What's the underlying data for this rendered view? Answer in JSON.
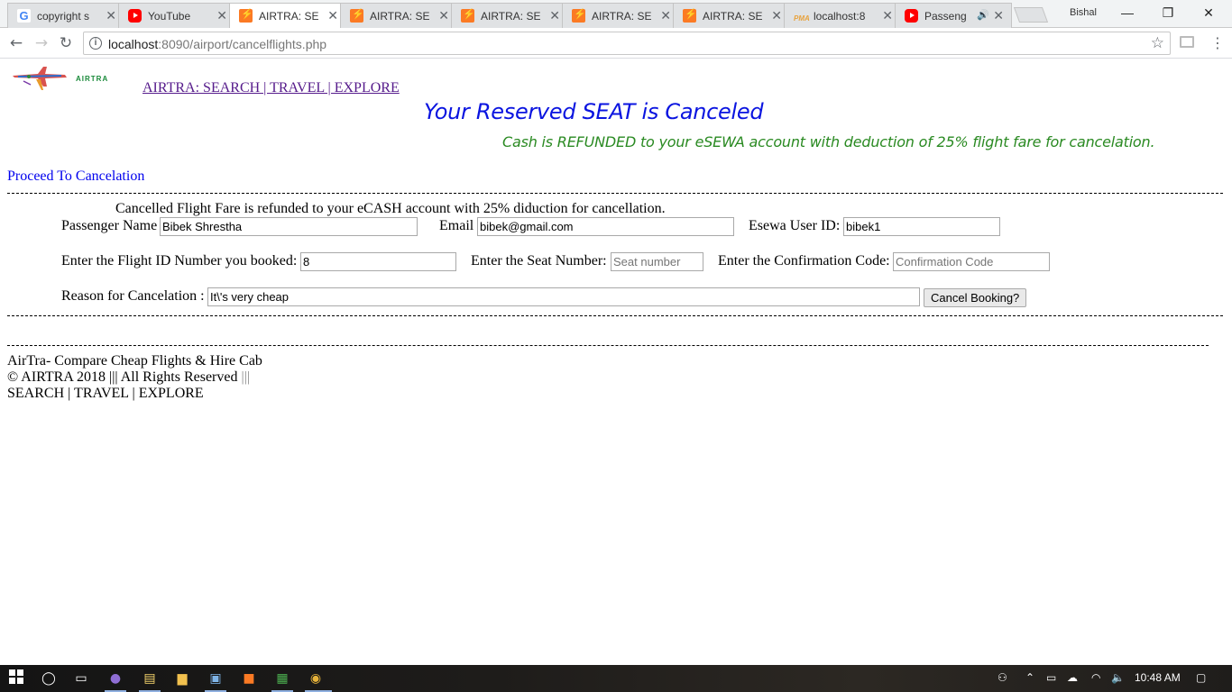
{
  "browser": {
    "tabs": [
      {
        "label": "copyright s",
        "icon": "google-icon"
      },
      {
        "label": "YouTube",
        "icon": "youtube-icon"
      },
      {
        "label": "AIRTRA: SE",
        "icon": "xampp-icon"
      },
      {
        "label": "AIRTRA: SE",
        "icon": "xampp-icon"
      },
      {
        "label": "AIRTRA: SE",
        "icon": "xampp-icon"
      },
      {
        "label": "AIRTRA: SE",
        "icon": "xampp-icon"
      },
      {
        "label": "AIRTRA: SE",
        "icon": "xampp-icon"
      },
      {
        "label": "localhost:8",
        "icon": "phpmyadmin-icon"
      },
      {
        "label": "Passeng",
        "icon": "youtube-icon"
      }
    ],
    "active_tab": 2,
    "profile_name": "Bishal",
    "url_host": "localhost",
    "url_rest": ":8090/airport/cancelflights.php"
  },
  "page": {
    "logo_text": "AIRTRA",
    "nav_link": "AIRTRA: SEARCH | TRAVEL | EXPLORE",
    "headline": "Your Reserved SEAT is Canceled",
    "subhead": "Cash is REFUNDED to your eSEWA account with deduction of 25% flight fare for cancelation.",
    "proceed_link": "Proceed To Cancelation",
    "refund_note": "Cancelled Flight Fare is refunded to your eCASH account with 25% diduction for cancellation.",
    "form": {
      "passenger_label": "Passenger Name",
      "passenger_value": "Bibek Shrestha",
      "email_label": "Email",
      "email_value": "bibek@gmail.com",
      "esewa_label": "Esewa User ID:",
      "esewa_value": "bibek1",
      "flight_label": "Enter the Flight ID Number you booked:",
      "flight_value": "8",
      "seat_label": "Enter the Seat Number:",
      "seat_placeholder": "Seat number",
      "code_label": "Enter the Confirmation Code:",
      "code_placeholder": "Confirmation Code",
      "reason_label": "Reason for Cancelation :",
      "reason_value": "It\\'s very cheap",
      "submit_label": "Cancel Booking?"
    },
    "footer": {
      "tagline": "AirTra- Compare Cheap Flights & Hire Cab",
      "copyright": "© AIRTRA 2018",
      "rights": "||| All Rights Reserved",
      "rights_end": "|||",
      "links": "SEARCH | TRAVEL | EXPLORE"
    }
  },
  "taskbar": {
    "time": "10:48 AM"
  },
  "colors": {
    "headline": "#0a14e0",
    "subhead": "#2a8a22",
    "visited_link": "#551a8b",
    "link": "#0000ee"
  }
}
